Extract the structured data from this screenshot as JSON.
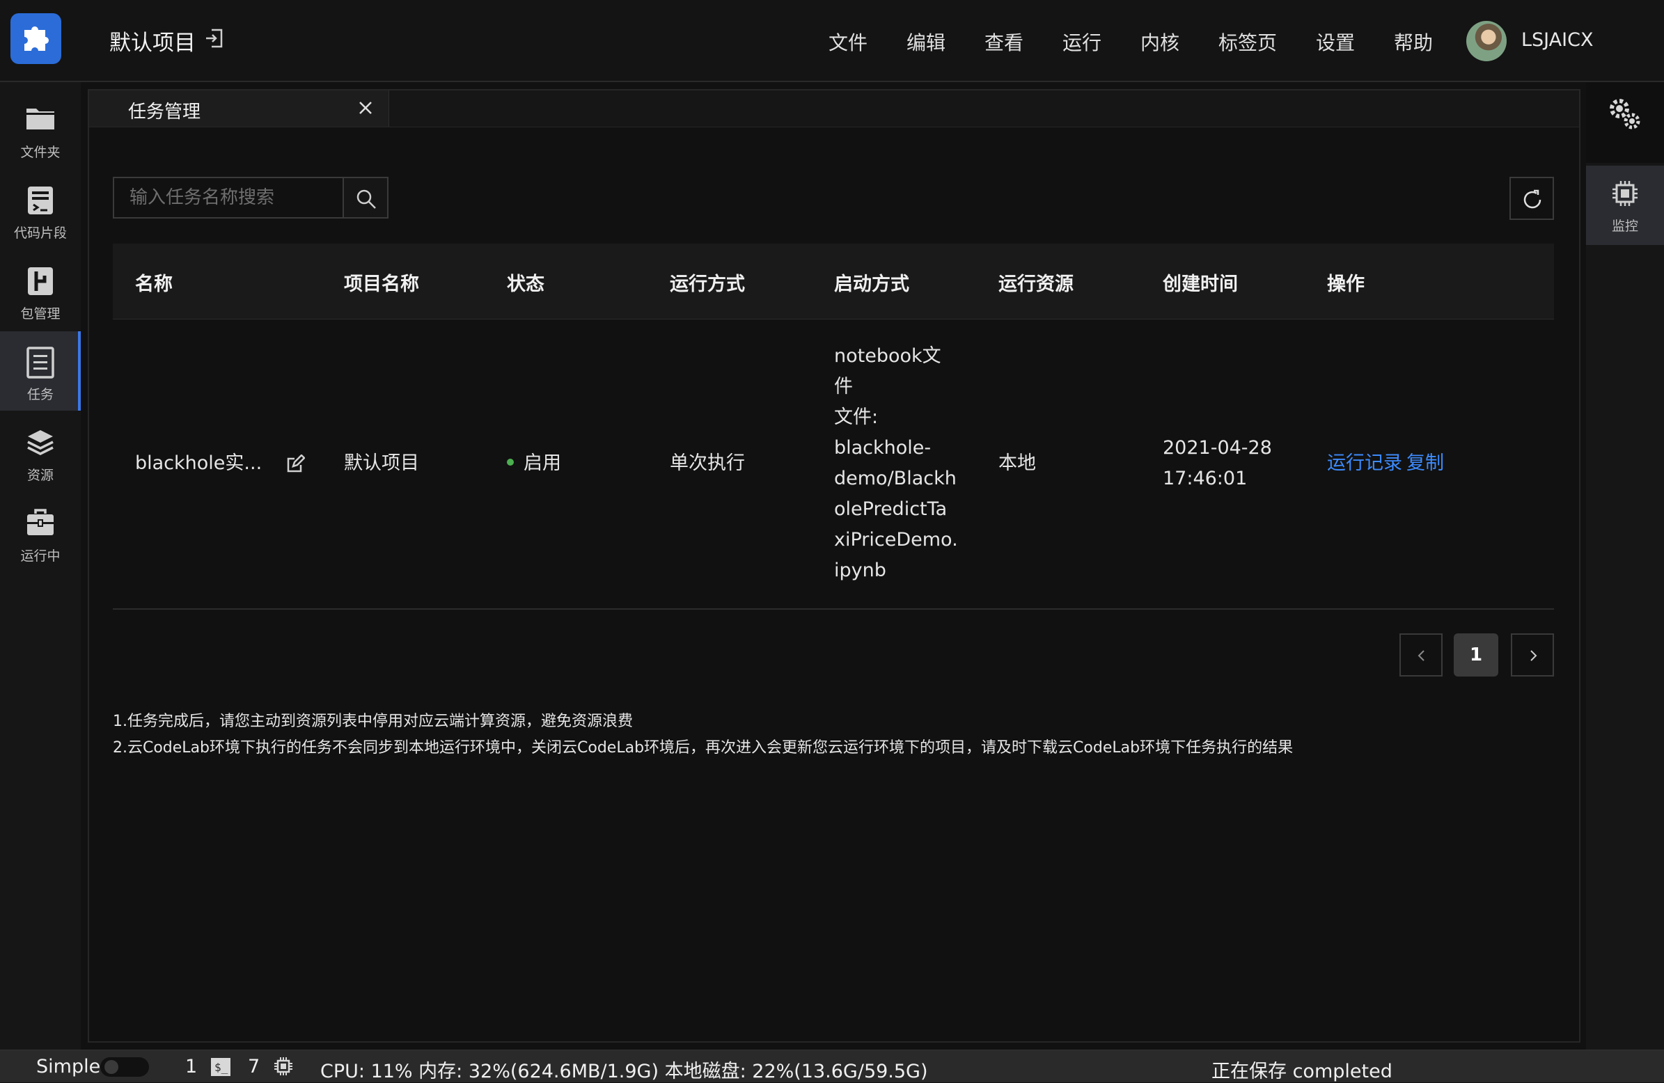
{
  "header": {
    "project_title": "默认项目",
    "menu": [
      "文件",
      "编辑",
      "查看",
      "运行",
      "内核",
      "标签页",
      "设置",
      "帮助"
    ],
    "username": "LSJAICX"
  },
  "sidebar": {
    "items": [
      {
        "label": "文件夹",
        "icon": "folder-icon"
      },
      {
        "label": "代码片段",
        "icon": "code-snippet-icon"
      },
      {
        "label": "包管理",
        "icon": "package-icon"
      },
      {
        "label": "任务",
        "icon": "task-icon",
        "active": true
      },
      {
        "label": "资源",
        "icon": "layers-icon"
      },
      {
        "label": "运行中",
        "icon": "briefcase-icon"
      }
    ]
  },
  "right_sidebar": {
    "monitor_label": "监控"
  },
  "tab": {
    "label": "任务管理"
  },
  "search": {
    "placeholder": "输入任务名称搜索",
    "value": ""
  },
  "table": {
    "columns": [
      "名称",
      "项目名称",
      "状态",
      "运行方式",
      "启动方式",
      "运行资源",
      "创建时间",
      "操作"
    ],
    "rows": [
      {
        "name": "blackhole实...",
        "project": "默认项目",
        "status": "启用",
        "run_mode": "单次执行",
        "launch_lines": [
          "notebook文",
          "件",
          "文件:",
          "blackhole-",
          "demo/Blackh",
          "olePredictTa",
          "xiPriceDemo.",
          "ipynb"
        ],
        "resource": "本地",
        "created_date": "2021-04-28",
        "created_time": "17:46:01",
        "action_log": "运行记录",
        "action_copy": "复制"
      }
    ]
  },
  "pagination": {
    "current": "1"
  },
  "notes": [
    "1.任务完成后，请您主动到资源列表中停用对应云端计算资源，避免资源浪费",
    "2.云CodeLab环境下执行的任务不会同步到本地运行环境中，关闭云CodeLab环境后，再次进入会更新您云运行环境下的项目，请及时下载云CodeLab环境下任务执行的结果"
  ],
  "statusbar": {
    "mode": "Simple",
    "terminals": "1",
    "kernels": "7",
    "metrics": "CPU:  11% 内存:  32%(624.6MB/1.9G) 本地磁盘:  22%(13.6G/59.5G)",
    "save_status": "正在保存 completed"
  }
}
